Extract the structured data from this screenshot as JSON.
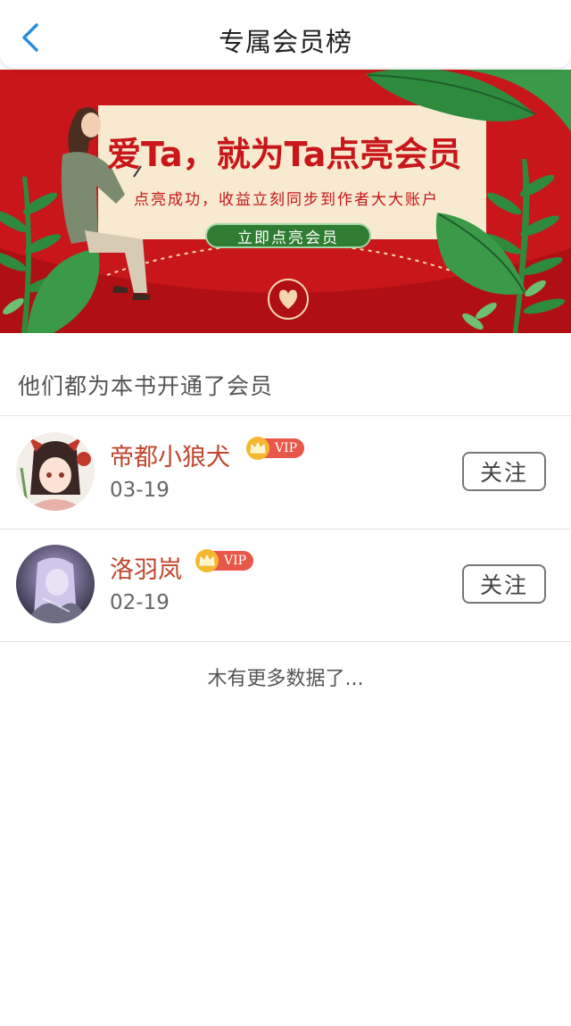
{
  "header": {
    "title": "专属会员榜",
    "back_icon": "chevron-left-icon",
    "accent_color": "#2b8ce0"
  },
  "banner": {
    "headline": "爱Ta，就为Ta点亮会员",
    "subtitle": "点亮成功，收益立刻同步到作者大大账户",
    "cta_label": "立即点亮会员",
    "background_color": "#c8161a"
  },
  "section": {
    "title": "他们都为本书开通了会员"
  },
  "members": [
    {
      "name": "帝都小狼犬",
      "badge": "VIP",
      "date": "03-19",
      "follow_label": "关注"
    },
    {
      "name": "洛羽岚",
      "badge": "VIP",
      "date": "02-19",
      "follow_label": "关注"
    }
  ],
  "footer": {
    "no_more_text": "木有更多数据了..."
  }
}
